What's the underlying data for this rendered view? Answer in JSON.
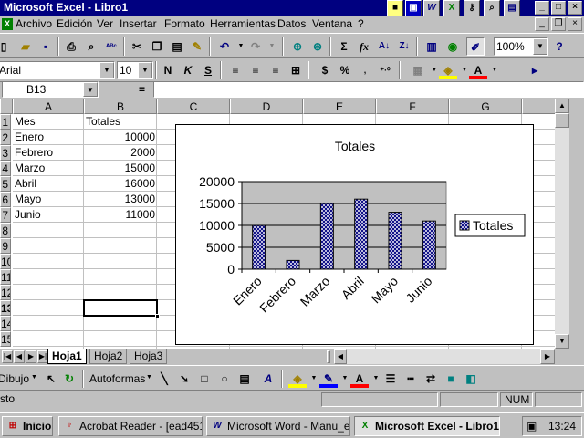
{
  "window": {
    "title": "Microsoft Excel - Libro1"
  },
  "menu": [
    "Archivo",
    "Edición",
    "Ver",
    "Insertar",
    "Formato",
    "Herramientas",
    "Datos",
    "Ventana",
    "?"
  ],
  "toolbar": {
    "zoom": "100%"
  },
  "format_bar": {
    "font": "Arial",
    "size": "10"
  },
  "formula_bar": {
    "name_box": "B13",
    "equals": "="
  },
  "columns": [
    "A",
    "B",
    "C",
    "D",
    "E",
    "F",
    "G"
  ],
  "rows": [
    "1",
    "2",
    "3",
    "4",
    "5",
    "6",
    "7",
    "8",
    "9",
    "10",
    "11",
    "12",
    "13",
    "14",
    "15"
  ],
  "sheet": {
    "header": [
      "Mes",
      "Totales"
    ],
    "data": [
      [
        "Enero",
        "10000"
      ],
      [
        "Febrero",
        "2000"
      ],
      [
        "Marzo",
        "15000"
      ],
      [
        "Abril",
        "16000"
      ],
      [
        "Mayo",
        "13000"
      ],
      [
        "Junio",
        "11000"
      ]
    ]
  },
  "chart_data": {
    "type": "bar",
    "title": "Totales",
    "categories": [
      "Enero",
      "Febrero",
      "Marzo",
      "Abril",
      "Mayo",
      "Junio"
    ],
    "series": [
      {
        "name": "Totales",
        "values": [
          10000,
          2000,
          15000,
          16000,
          13000,
          11000
        ]
      }
    ],
    "yticks": [
      "20000",
      "15000",
      "10000",
      "5000",
      "0"
    ],
    "ylim": [
      0,
      20000
    ],
    "legend": "right",
    "grid": true
  },
  "tabs": [
    "Hoja1",
    "Hoja2",
    "Hoja3"
  ],
  "drawing": {
    "dibujo": "Dibujo",
    "autoformas": "Autoformas"
  },
  "status": {
    "text": "sto",
    "num": "NUM"
  },
  "taskbar": {
    "start": "Inicio",
    "tasks": [
      "Acrobat Reader - [ead451-...",
      "Microsoft Word - Manu_ex...",
      "Microsoft Excel - Libro1"
    ],
    "clock": "13:24"
  }
}
